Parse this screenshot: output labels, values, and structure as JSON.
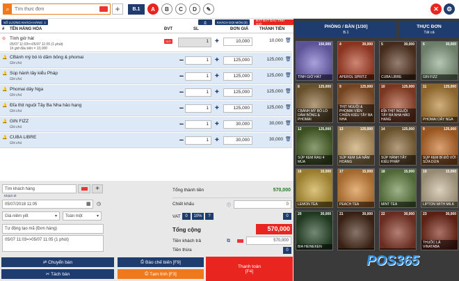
{
  "header": {
    "search_placeholder": "Tìm thực đơn",
    "table_badge": "B.1",
    "layer_buttons": [
      "A",
      "B",
      "C",
      "D"
    ]
  },
  "tags": {
    "guest_count": "SỐ LƯỢNG KHÁCH HÀNG",
    "guest_value": "1",
    "call_guest": "KHÁCH GỌI MÓN (0)",
    "start_time": "ĐẶT BẮT ĐẦU TÍNH GIỜ"
  },
  "columns": {
    "index": "#",
    "name": "TÊN HÀNG HÓA",
    "unit": "ĐVT",
    "qty": "SL",
    "price": "ĐƠN GIÁ",
    "total": "THÀNH TIỀN"
  },
  "order_items": [
    {
      "name": "Tính giờ hát",
      "note": "05/07 11:03=>05/07 11:05 (1 phút)",
      "note2": "1h giờ đầu tiên = 10,000",
      "badge": "GIỜ",
      "qty": "1",
      "price": "10,000",
      "total": "10,000"
    },
    {
      "name": "CBánh mỳ bò lò dăm bông & phomai",
      "note": "Ghi chú",
      "qty": "1",
      "price": "125,000",
      "total": "125,000"
    },
    {
      "name": "Súp hành tây kiểu Pháp",
      "note": "Ghi chú",
      "qty": "1",
      "price": "125,000",
      "total": "125,000"
    },
    {
      "name": "Phomai dây Nga",
      "note": "Ghi chú",
      "qty": "1",
      "price": "125,000",
      "total": "125,000"
    },
    {
      "name": "Đĩa thịt nguội Tây Ba Nha hảo hạng",
      "note": "Ghi chú",
      "qty": "1",
      "price": "125,000",
      "total": "125,000"
    },
    {
      "name": "GIN FIZZ",
      "note": "Ghi chú",
      "qty": "1",
      "price": "30,000",
      "total": "30,000"
    },
    {
      "name": "CUBA LIBRE",
      "note": "Ghi chú",
      "qty": "1",
      "price": "30,000",
      "total": "30,000"
    }
  ],
  "customer": {
    "search_placeholder": "Tìm khách hàng",
    "guest_label": "Khách lẻ",
    "date": "05/07/2018 11:05",
    "price_list": "Giá niêm yết",
    "all_label": "Toàn một",
    "order_code_placeholder": "Tự động tạo mã (Đơn hàng)",
    "time_note": "05/07 11:03=>05/07 11:05 (1 phút)"
  },
  "summary": {
    "subtotal_label": "Tổng thành tiền",
    "subtotal": "570,000",
    "discount_label": "Chiết khấu",
    "discount": "0",
    "vat_label": "VAT",
    "vat_options": [
      "0",
      "10%",
      "?"
    ],
    "vat": "0",
    "grand_label": "Tổng cộng",
    "grand": "570,000",
    "paid_label": "Tiền khách trả",
    "paid": "570,000",
    "change_label": "Tiền thừa",
    "change": "0"
  },
  "actions": {
    "move_table": "Chuyển bàn",
    "split_table": "Tách bàn",
    "kitchen": "Báo chế biến [F9]",
    "provisional": "Tạm tính [F3]",
    "pay": "Thanh toán",
    "pay_key": "[F4]"
  },
  "right_tabs": {
    "rooms": "PHÒNG / BÀN [1/30]",
    "rooms_sub": "B.1",
    "menu": "THỰC ĐƠN",
    "menu_sub": "Tất cả"
  },
  "products": [
    {
      "n": "",
      "p": "150,000",
      "label": "TÍNH GIỜ HÁT",
      "color": "#7a6fc9"
    },
    {
      "n": "4",
      "p": "30,000",
      "label": "APEROL SPRITZ",
      "color": "#b5452a"
    },
    {
      "n": "5",
      "p": "30,000",
      "label": "CUBA LIBRE",
      "color": "#5c3a25"
    },
    {
      "n": "6",
      "p": "30,000",
      "label": "GIN FIZZ",
      "color": "#8fa88a"
    },
    {
      "n": "8",
      "p": "125,000",
      "label": "CBÁNH MỲ BÒ LÒ DĂM BÔNG & PHOMAI",
      "color": "#8a6a3a"
    },
    {
      "n": "9",
      "p": "125,000",
      "label": "THỊT NGUỘI & PHOMAI VIÊN CHIÊN KIỂU TÂY BA NHA",
      "color": "#9a5a2a"
    },
    {
      "n": "10",
      "p": "125,000",
      "label": "ĐĨA THỊT NGUỘI TÂY BA NHA HẢO HẠNG",
      "color": "#a2492a"
    },
    {
      "n": "11",
      "p": "125,000",
      "label": "PHOMAI DÂY NGA",
      "color": "#b8863a"
    },
    {
      "n": "12",
      "p": "125,000",
      "label": "SÚP KEM RAU 4 MÙA",
      "color": "#4f6a2a"
    },
    {
      "n": "13",
      "p": "125,000",
      "label": "SÚP KEM GÀ NẤM HOÀNG",
      "color": "#c6a165"
    },
    {
      "n": "14",
      "p": "125,000",
      "label": "SÚP HÀNH TÂY KIỂU PHÁP",
      "color": "#8a6a3a"
    },
    {
      "n": "9",
      "p": "125,000",
      "label": "SÚP KEM BÍ ĐỎ VỚI SỮA DỪA",
      "color": "#c9712a"
    },
    {
      "n": "16",
      "p": "15,000",
      "label": "LEMON TEA",
      "color": "#c9a53a"
    },
    {
      "n": "17",
      "p": "15,000",
      "label": "PEACH TEA",
      "color": "#d88a3a"
    },
    {
      "n": "18",
      "p": "15,000",
      "label": "MINT TEA",
      "color": "#6a8a4a"
    },
    {
      "n": "19",
      "p": "15,000",
      "label": "LIPTON WITH MILK",
      "color": "#c8b89a"
    },
    {
      "n": "20",
      "p": "30,000",
      "label": "BIA HEINEKEN",
      "color": "#2a4a2a"
    },
    {
      "n": "21",
      "p": "30,000",
      "label": "",
      "color": "#4a2a1a"
    },
    {
      "n": "22",
      "p": "30,000",
      "label": "",
      "color": "#8a3a2a"
    },
    {
      "n": "23",
      "p": "30,000",
      "label": "THUỐC LÁ VINATABA",
      "color": "#7a2a1a"
    }
  ],
  "brand": "POS365"
}
